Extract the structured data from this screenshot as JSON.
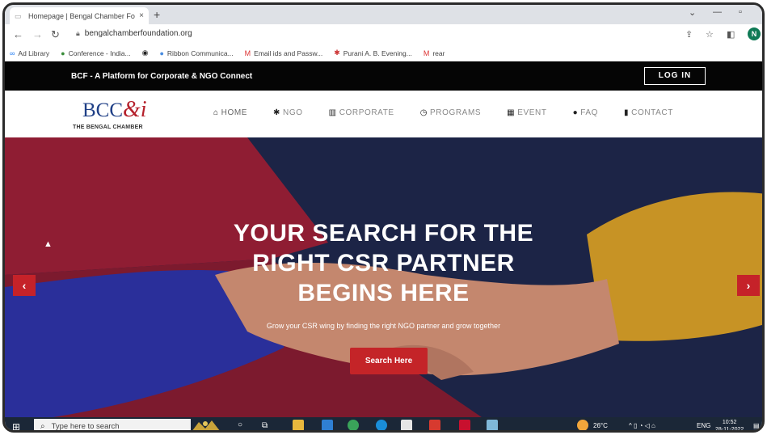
{
  "browser": {
    "tab_title": "Homepage | Bengal Chamber Fo",
    "tab_close": "×",
    "new_tab": "+",
    "url": "bengalchamberfoundation.org",
    "profile_initial": "N",
    "bookmarks": [
      {
        "label": "Ad Library",
        "icon": "meta-icon"
      },
      {
        "label": "Conference - India...",
        "icon": "globe-icon"
      },
      {
        "label": "",
        "icon": "github-icon"
      },
      {
        "label": "Ribbon Communica...",
        "icon": "globe-icon"
      },
      {
        "label": "Email ids and Passw...",
        "icon": "gmail-icon"
      },
      {
        "label": "Purani A. B. Evening...",
        "icon": "flag-icon"
      },
      {
        "label": "rear",
        "icon": "gmail-icon"
      }
    ]
  },
  "site": {
    "tagline": "BCF - A Platform for Corporate & NGO Connect",
    "login_label": "LOG IN",
    "logo_text": "BCC",
    "logo_amp": "&i",
    "logo_sub": "THE BENGAL CHAMBER",
    "nav": [
      {
        "label": "HOME",
        "icon": "home-icon",
        "glyph": "⌂"
      },
      {
        "label": "NGO",
        "icon": "paw-icon",
        "glyph": "✱"
      },
      {
        "label": "CORPORATE",
        "icon": "building-icon",
        "glyph": "▥"
      },
      {
        "label": "PROGRAMS",
        "icon": "clock-icon",
        "glyph": "◷"
      },
      {
        "label": "EVENT",
        "icon": "calendar-icon",
        "glyph": "▦"
      },
      {
        "label": "FAQ",
        "icon": "question-icon",
        "glyph": "●"
      },
      {
        "label": "CONTACT",
        "icon": "contact-icon",
        "glyph": "▮"
      }
    ]
  },
  "hero": {
    "headline": [
      "YOUR SEARCH FOR THE",
      "RIGHT CSR PARTNER",
      "BEGINS HERE"
    ],
    "subline": "Grow your CSR wing by finding the right NGO partner and grow together",
    "button_label": "Search Here",
    "prev_arrow": "‹",
    "next_arrow": "›"
  },
  "taskbar": {
    "search_placeholder": "Type here to search",
    "temperature": "26°C",
    "language": "ENG",
    "time": "10:52",
    "date": "28-11-2022"
  }
}
